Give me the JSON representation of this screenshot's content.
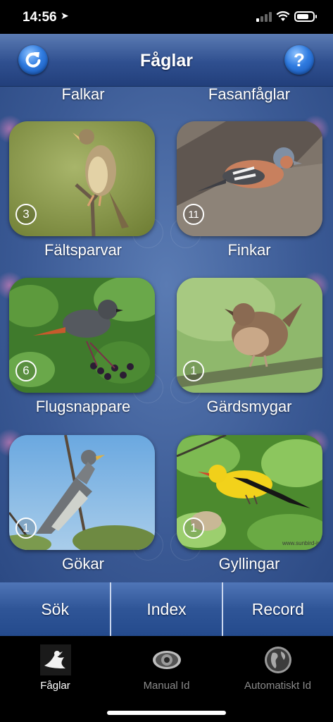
{
  "status_bar": {
    "time": "14:56",
    "location_icon": "location-arrow-icon",
    "battery_level": 0.75
  },
  "header": {
    "title": "Fåglar",
    "refresh_icon": "refresh-icon",
    "help_label": "?"
  },
  "top_labels": [
    "Falkar",
    "Fasanfåglar"
  ],
  "families": [
    {
      "name": "Fältsparvar",
      "count": "3"
    },
    {
      "name": "Finkar",
      "count": "11"
    },
    {
      "name": "Flugsnappare",
      "count": "6"
    },
    {
      "name": "Gärdsmygar",
      "count": "1"
    },
    {
      "name": "Gökar",
      "count": "1"
    },
    {
      "name": "Gyllingar",
      "count": "1"
    }
  ],
  "photo_credit": "www.sunbird-image",
  "actions": {
    "search": "Sök",
    "index": "Index",
    "record": "Record"
  },
  "tabs": [
    {
      "label": "Fåglar",
      "icon": "bird-icon",
      "active": true
    },
    {
      "label": "Manual Id",
      "icon": "eye-icon",
      "active": false
    },
    {
      "label": "Automatiskt Id",
      "icon": "globe-icon",
      "active": false
    }
  ]
}
